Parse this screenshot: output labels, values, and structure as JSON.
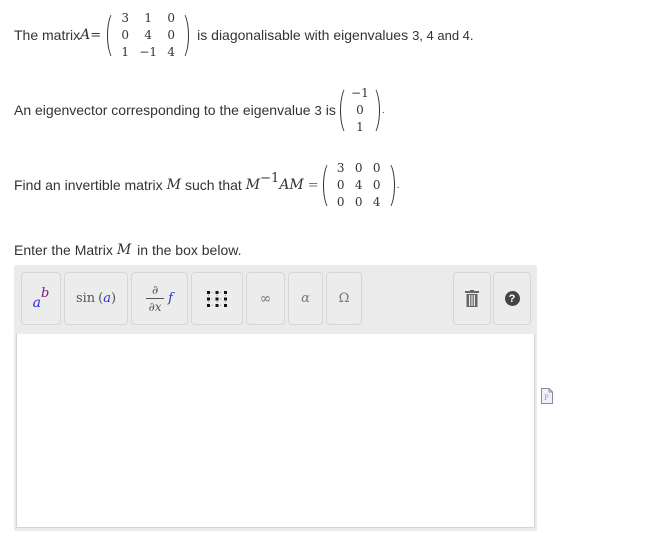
{
  "question": {
    "line1": {
      "prefix": "The matrix ",
      "symbol": "A",
      "equals": " =",
      "matrix": [
        [
          "3",
          "1",
          "0"
        ],
        [
          "0",
          "4",
          "0"
        ],
        [
          "1",
          "−1",
          "4"
        ]
      ],
      "suffix": "is diagonalisable with eigenvalues",
      "eigenvalues": "3, 4 and 4."
    },
    "line2": {
      "prefix": "An eigenvector corresponding to the eigenvalue",
      "eigenvalue": "3",
      "is": "is",
      "vector": [
        [
          "−1"
        ],
        [
          "0"
        ],
        [
          "1"
        ]
      ],
      "suffix": "."
    },
    "line3": {
      "prefix": "Find an invertible matrix",
      "symbol": "M",
      "middle": "such that",
      "expr_m": "M",
      "expr_sup": "−1",
      "expr_am": "AM",
      "equals": "=",
      "matrix": [
        [
          "3",
          "0",
          "0"
        ],
        [
          "0",
          "4",
          "0"
        ],
        [
          "0",
          "0",
          "4"
        ]
      ],
      "suffix": "."
    },
    "instruction": {
      "prefix": "Enter the Matrix",
      "symbol": "M",
      "suffix": "in the box below."
    }
  },
  "toolbar": {
    "buttons": [
      {
        "name": "superscript",
        "base": "a",
        "sup": "b"
      },
      {
        "name": "function",
        "fn": "sin",
        "arg": "a"
      },
      {
        "name": "derivative",
        "num": "∂",
        "den": "∂x",
        "f": "f"
      },
      {
        "name": "matrix",
        "icon": "matrix-grid-icon"
      },
      {
        "name": "infinity",
        "label": "∞"
      },
      {
        "name": "greek",
        "label": "α"
      },
      {
        "name": "symbols",
        "label": "Ω"
      },
      {
        "name": "clear",
        "icon": "trash-icon"
      },
      {
        "name": "help",
        "icon": "help-icon",
        "label": "?"
      }
    ]
  },
  "editor": {
    "value": ""
  },
  "colors": {
    "accent_blue": "#2a2ae0",
    "accent_purple": "#7a1a8a",
    "text": "#333333"
  }
}
